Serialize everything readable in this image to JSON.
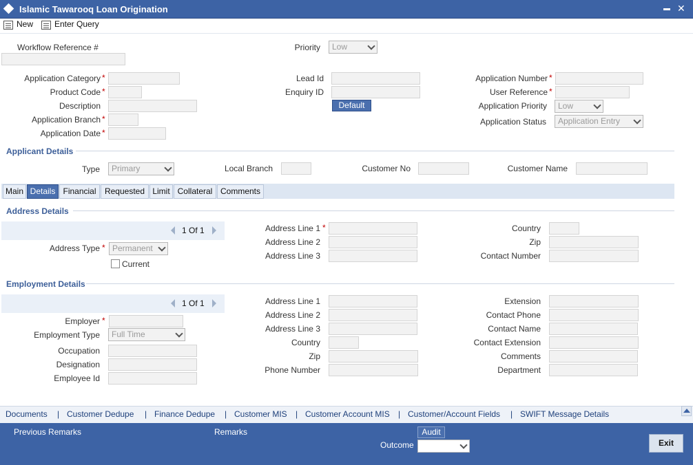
{
  "window": {
    "title": "Islamic Tawarooq Loan Origination"
  },
  "toolbar": {
    "new_label": "New",
    "enter_query_label": "Enter Query"
  },
  "header": {
    "workflow_ref_label": "Workflow Reference #",
    "priority_label": "Priority",
    "priority_value": "Low",
    "app_category_label": "Application Category",
    "product_code_label": "Product Code",
    "description_label": "Description",
    "app_branch_label": "Application Branch",
    "app_date_label": "Application Date",
    "lead_id_label": "Lead Id",
    "enquiry_id_label": "Enquiry ID",
    "default_button": "Default",
    "app_number_label": "Application Number",
    "user_reference_label": "User Reference",
    "app_priority_label": "Application Priority",
    "app_priority_value": "Low",
    "app_status_label": "Application Status",
    "app_status_value": "Application Entry",
    "required_mark": "*"
  },
  "applicant": {
    "section_title": "Applicant Details",
    "type_label": "Type",
    "type_value": "Primary",
    "local_branch_label": "Local Branch",
    "customer_no_label": "Customer No",
    "customer_name_label": "Customer Name"
  },
  "tabs": [
    "Main",
    "Details",
    "Financial",
    "Requested",
    "Limit",
    "Collateral",
    "Comments"
  ],
  "address": {
    "section_title": "Address Details",
    "pager_text": "1 Of 1",
    "address_type_label": "Address Type",
    "address_type_value": "Permanent",
    "current_label": "Current",
    "line1_label": "Address Line 1",
    "line2_label": "Address Line 2",
    "line3_label": "Address Line 3",
    "country_label": "Country",
    "zip_label": "Zip",
    "contact_number_label": "Contact Number"
  },
  "employment": {
    "section_title": "Employment Details",
    "pager_text": "1 Of 1",
    "employer_label": "Employer",
    "employment_type_label": "Employment Type",
    "employment_type_value": "Full Time",
    "occupation_label": "Occupation",
    "designation_label": "Designation",
    "employee_id_label": "Employee Id",
    "line1_label": "Address Line 1",
    "line2_label": "Address Line 2",
    "line3_label": "Address Line 3",
    "country_label": "Country",
    "zip_label": "Zip",
    "phone_label": "Phone Number",
    "extension_label": "Extension",
    "contact_phone_label": "Contact Phone",
    "contact_name_label": "Contact Name",
    "contact_extension_label": "Contact Extension",
    "comments_label": "Comments",
    "department_label": "Department"
  },
  "footer_links": {
    "documents": "Documents",
    "customer_dedupe": "Customer Dedupe",
    "finance_dedupe": "Finance Dedupe",
    "customer_mis": "Customer MIS",
    "customer_account_mis": "Customer Account MIS",
    "customer_account_fields": "Customer/Account Fields",
    "swift_message_details": "SWIFT Message Details",
    "separator": "|"
  },
  "footer": {
    "previous_remarks_label": "Previous Remarks",
    "remarks_label": "Remarks",
    "audit_button": "Audit",
    "outcome_label": "Outcome",
    "exit_button": "Exit"
  },
  "colors": {
    "title_bar": "#3d63a5",
    "section_title": "#3d5f99",
    "required": "#c00000"
  }
}
